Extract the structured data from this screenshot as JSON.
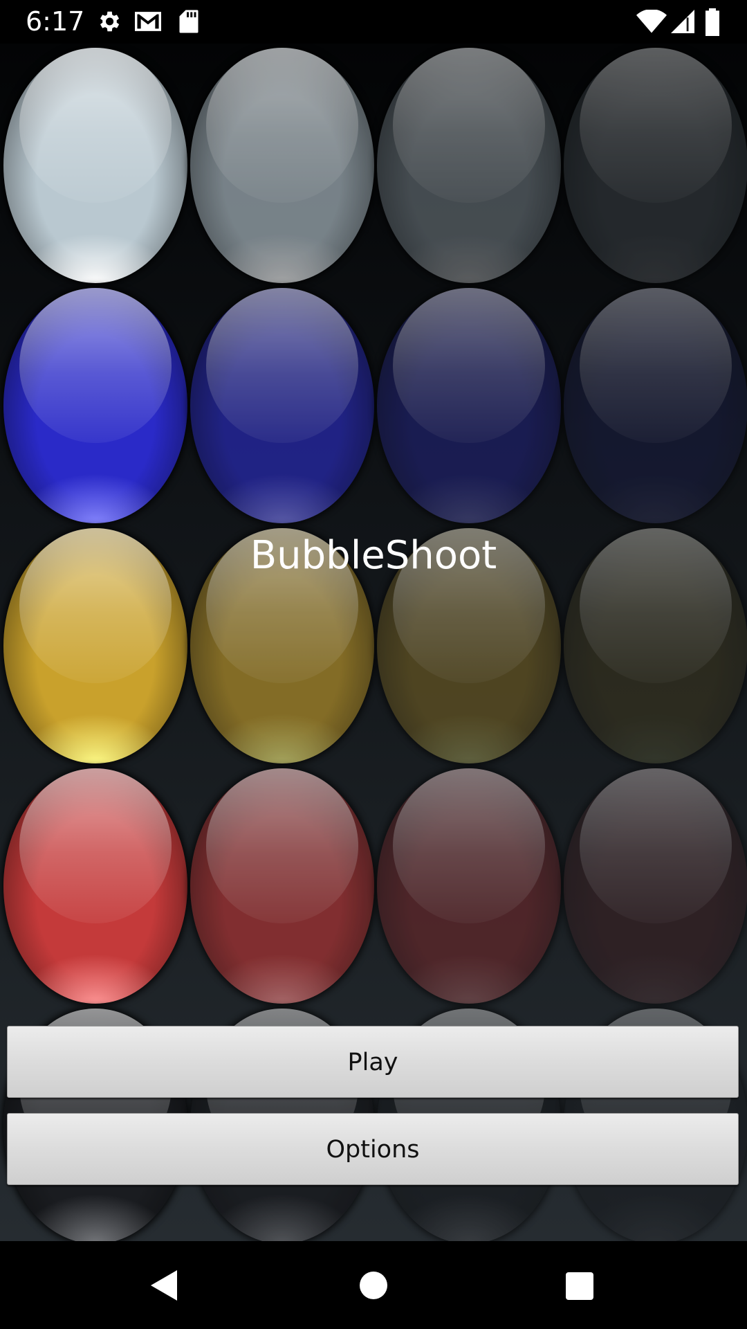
{
  "status_bar": {
    "time": "6:17",
    "left_icons": [
      "gear-icon",
      "gmail-icon",
      "sd-card-icon"
    ],
    "right_icons": [
      "wifi-icon",
      "cell-signal-icon",
      "battery-icon"
    ]
  },
  "app": {
    "title": "BubbleShoot"
  },
  "background_bubbles": {
    "rows": [
      {
        "color": "white",
        "hex": "#b9c8d0"
      },
      {
        "color": "blue",
        "hex": "#2a2ac8"
      },
      {
        "color": "yellow",
        "hex": "#c9a12c"
      },
      {
        "color": "red",
        "hex": "#c43a3a"
      },
      {
        "color": "black",
        "hex": "#1a1c20"
      }
    ],
    "fade_per_column": [
      1.0,
      0.72,
      0.45,
      0.22
    ]
  },
  "menu": {
    "play_label": "Play",
    "options_label": "Options"
  },
  "nav_bar": {
    "icons": [
      "back-icon",
      "home-icon",
      "recents-icon"
    ]
  }
}
